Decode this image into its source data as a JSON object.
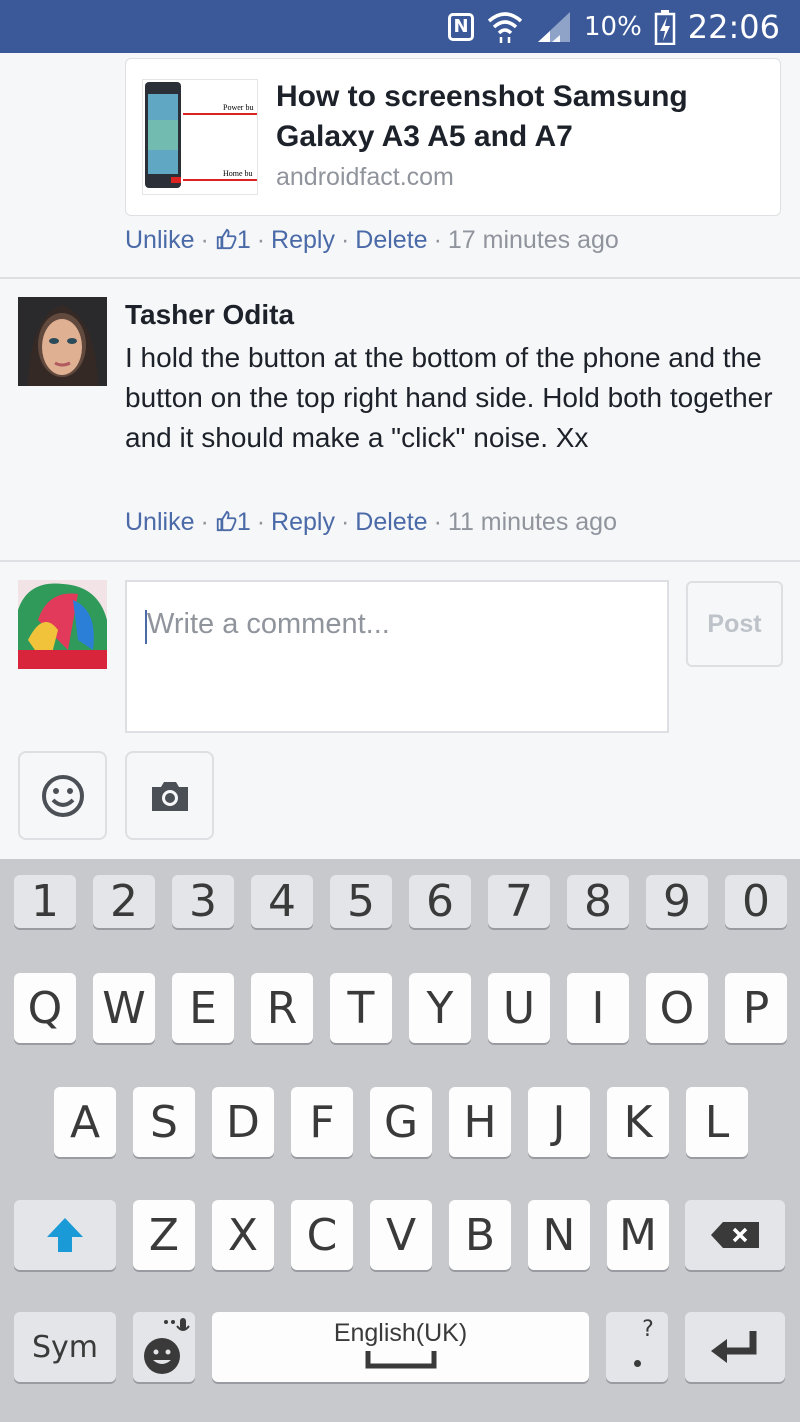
{
  "status_bar": {
    "nfc_label": "N",
    "battery": "10%",
    "time": "22:06"
  },
  "link_card": {
    "thumb_label_top": "Power bu",
    "thumb_label_bottom": "Home bu",
    "title": "How to screenshot Samsung Galaxy A3 A5 and A7",
    "domain": "androidfact.com"
  },
  "first_actions": {
    "unlike": "Unlike",
    "likes": "1",
    "reply": "Reply",
    "delete": "Delete",
    "time": "17 minutes ago"
  },
  "comment": {
    "author": "Tasher Odita",
    "text": "I hold the button at the bottom of the phone and the button on the top right hand side. Hold both together and it should make a \"click\" noise. Xx",
    "actions": {
      "unlike": "Unlike",
      "likes": "1",
      "reply": "Reply",
      "delete": "Delete",
      "time": "11 minutes ago"
    }
  },
  "composer": {
    "placeholder": "Write a comment...",
    "post_label": "Post"
  },
  "keyboard": {
    "numbers": [
      "1",
      "2",
      "3",
      "4",
      "5",
      "6",
      "7",
      "8",
      "9",
      "0"
    ],
    "row1": [
      "Q",
      "W",
      "E",
      "R",
      "T",
      "Y",
      "U",
      "I",
      "O",
      "P"
    ],
    "row2": [
      "A",
      "S",
      "D",
      "F",
      "G",
      "H",
      "J",
      "K",
      "L"
    ],
    "row3": [
      "Z",
      "X",
      "C",
      "V",
      "B",
      "N",
      "M"
    ],
    "sym_label": "Sym",
    "space_label": "English(UK)",
    "punct_label": "?"
  },
  "colors": {
    "brand": "#3b5998",
    "link": "#4b6aa8",
    "shift": "#1a9ad6"
  }
}
